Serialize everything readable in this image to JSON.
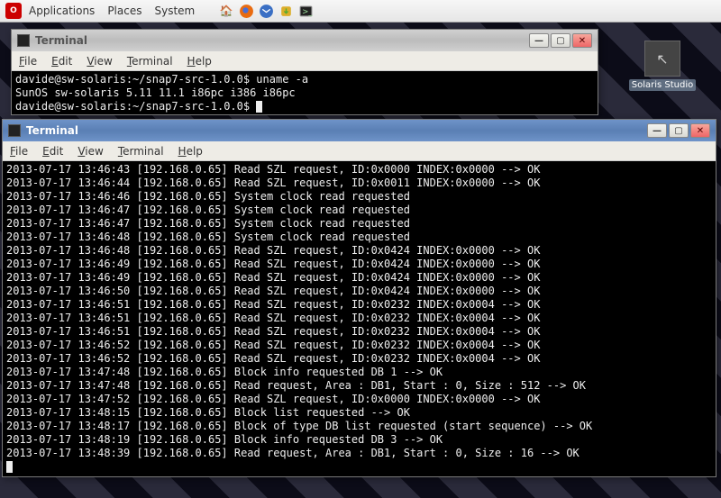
{
  "panel": {
    "menus": [
      "Applications",
      "Places",
      "System"
    ],
    "icons": [
      "home-icon",
      "firefox-icon",
      "thunderbird-icon",
      "updates-icon",
      "terminal-icon"
    ]
  },
  "desktop_icon": {
    "label": "Solaris Studio"
  },
  "windows": {
    "w1": {
      "title": "Terminal",
      "menus": [
        "File",
        "Edit",
        "View",
        "Terminal",
        "Help"
      ],
      "lines": [
        "davide@sw-solaris:~/snap7-src-1.0.0$ uname -a",
        "SunOS sw-solaris 5.11 11.1 i86pc i386 i86pc",
        "davide@sw-solaris:~/snap7-src-1.0.0$ "
      ]
    },
    "w2": {
      "title": "Terminal",
      "menus": [
        "File",
        "Edit",
        "View",
        "Terminal",
        "Help"
      ],
      "lines": [
        "2013-07-17 13:46:43 [192.168.0.65] Read SZL request, ID:0x0000 INDEX:0x0000 --> OK",
        "2013-07-17 13:46:44 [192.168.0.65] Read SZL request, ID:0x0011 INDEX:0x0000 --> OK",
        "2013-07-17 13:46:46 [192.168.0.65] System clock read requested",
        "2013-07-17 13:46:47 [192.168.0.65] System clock read requested",
        "2013-07-17 13:46:47 [192.168.0.65] System clock read requested",
        "2013-07-17 13:46:48 [192.168.0.65] System clock read requested",
        "2013-07-17 13:46:48 [192.168.0.65] Read SZL request, ID:0x0424 INDEX:0x0000 --> OK",
        "2013-07-17 13:46:49 [192.168.0.65] Read SZL request, ID:0x0424 INDEX:0x0000 --> OK",
        "2013-07-17 13:46:49 [192.168.0.65] Read SZL request, ID:0x0424 INDEX:0x0000 --> OK",
        "2013-07-17 13:46:50 [192.168.0.65] Read SZL request, ID:0x0424 INDEX:0x0000 --> OK",
        "2013-07-17 13:46:51 [192.168.0.65] Read SZL request, ID:0x0232 INDEX:0x0004 --> OK",
        "2013-07-17 13:46:51 [192.168.0.65] Read SZL request, ID:0x0232 INDEX:0x0004 --> OK",
        "2013-07-17 13:46:51 [192.168.0.65] Read SZL request, ID:0x0232 INDEX:0x0004 --> OK",
        "2013-07-17 13:46:52 [192.168.0.65] Read SZL request, ID:0x0232 INDEX:0x0004 --> OK",
        "2013-07-17 13:46:52 [192.168.0.65] Read SZL request, ID:0x0232 INDEX:0x0004 --> OK",
        "2013-07-17 13:47:48 [192.168.0.65] Block info requested DB 1 --> OK",
        "2013-07-17 13:47:48 [192.168.0.65] Read request, Area : DB1, Start : 0, Size : 512 --> OK",
        "2013-07-17 13:47:52 [192.168.0.65] Read SZL request, ID:0x0000 INDEX:0x0000 --> OK",
        "2013-07-17 13:48:15 [192.168.0.65] Block list requested --> OK",
        "2013-07-17 13:48:17 [192.168.0.65] Block of type DB list requested (start sequence) --> OK",
        "2013-07-17 13:48:19 [192.168.0.65] Block info requested DB 3 --> OK",
        "2013-07-17 13:48:39 [192.168.0.65] Read request, Area : DB1, Start : 0, Size : 16 --> OK"
      ]
    }
  }
}
